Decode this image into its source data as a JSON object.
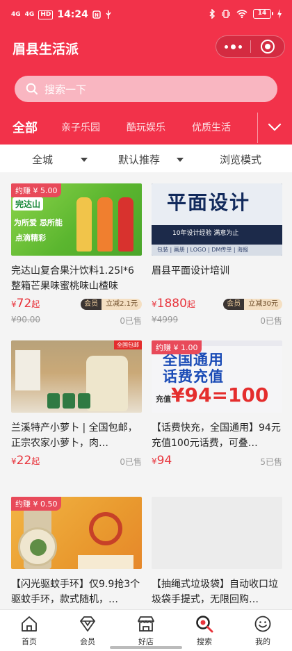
{
  "status_bar": {
    "time": "14:24",
    "battery": "14",
    "signal1": "4G",
    "signal2": "4G",
    "hd": "HD"
  },
  "header": {
    "title": "眉县生活派"
  },
  "search": {
    "placeholder": "搜索一下"
  },
  "categories": [
    {
      "label": "全部",
      "active": true
    },
    {
      "label": "亲子乐园",
      "active": false
    },
    {
      "label": "酷玩娱乐",
      "active": false
    },
    {
      "label": "优质生活",
      "active": false
    }
  ],
  "filters": {
    "area": "全城",
    "sort": "默认推荐",
    "mode": "浏览模式"
  },
  "products": [
    {
      "earn": "约赚 ¥ 5.00",
      "image_text": {
        "logo": "完达山",
        "slogan": "为所爱 忌所能",
        "slogan2": "点滴精彩"
      },
      "name": "完达山复合果汁饮料1.25l*6整箱芒果味蜜桃味山楂味",
      "currency": "¥",
      "price": "72",
      "suffix": "起",
      "member_label": "会员",
      "member_discount": "立减2.1元",
      "original": "¥90.00",
      "sold": "0已售"
    },
    {
      "earn": "",
      "image_text": {
        "big": "平面设计",
        "sub": "10年设计经验  满意为止",
        "bar": "包装 | 画册 | LOGO | DM传单 | 海报"
      },
      "name": "眉县平面设计培训",
      "currency": "¥",
      "price": "1880",
      "suffix": "起",
      "member_label": "会员",
      "member_discount": "立减30元",
      "original": "¥4999",
      "sold": "0已售"
    },
    {
      "earn": "",
      "image_text": {
        "label": "全国包邮"
      },
      "name": "兰溪特产小萝卜 | 全国包邮，正宗农家小萝卜，肉…",
      "currency": "¥",
      "price": "22",
      "suffix": "起",
      "sold": "0已售"
    },
    {
      "earn": "约赚 ¥ 1.00",
      "image_text": {
        "h1": "全国通用",
        "h2": "话费充值",
        "h3": "¥94=100",
        "h3_small": "充值"
      },
      "name": "【话费快充，全国通用】94元充值100元话费，可叠…",
      "currency": "¥",
      "price": "94",
      "suffix": "",
      "sold": "5已售"
    },
    {
      "earn": "约赚 ¥ 0.50",
      "image_text": {},
      "name": "【闪光驱蚊手环】仅9.9抢3个驱蚊手环，款式随机，…",
      "currency": "¥",
      "price": "",
      "suffix": "",
      "sold": ""
    },
    {
      "earn": "",
      "image_text": {},
      "name": "【抽绳式垃圾袋】自动收口垃圾袋手提式，无限回购…",
      "currency": "¥",
      "price": "",
      "suffix": "",
      "sold": ""
    }
  ],
  "tabs": [
    {
      "label": "首页",
      "icon": "home-icon"
    },
    {
      "label": "会员",
      "icon": "diamond-icon"
    },
    {
      "label": "好店",
      "icon": "shop-icon"
    },
    {
      "label": "搜索",
      "icon": "search-icon"
    },
    {
      "label": "我的",
      "icon": "smile-icon"
    }
  ],
  "colors": {
    "brand_red": "#f2324a",
    "price_red": "#e8343c",
    "member_dark": "#3a3432",
    "member_gold": "#f4dfc2"
  }
}
